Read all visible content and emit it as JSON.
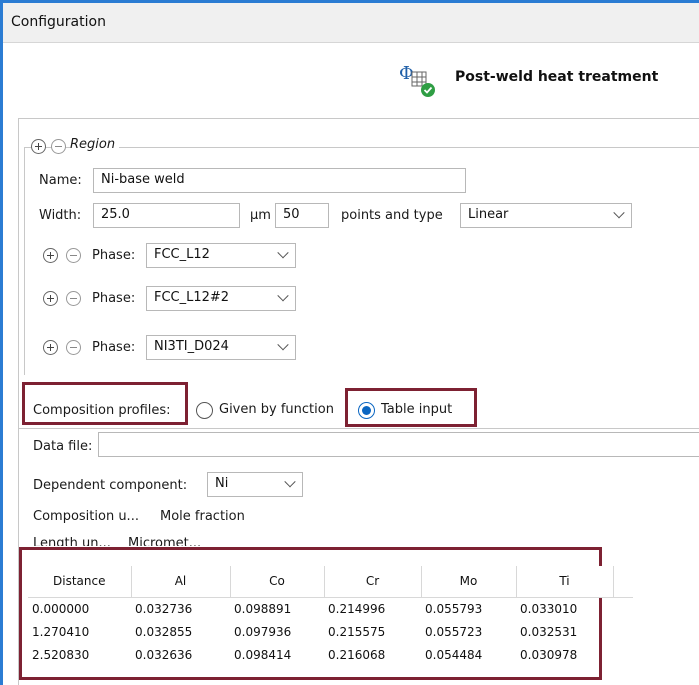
{
  "window": {
    "title": "Configuration"
  },
  "header": {
    "title": "Post-weld heat treatment",
    "icon": "phase-diagram-check-icon"
  },
  "region": {
    "legend": "Region",
    "name_label": "Name:",
    "name_value": "Ni-base weld",
    "width_label": "Width:",
    "width_value": "25.0",
    "width_unit": "µm",
    "points_value": "50",
    "points_label": "points and type",
    "type_value": "Linear",
    "phases": [
      {
        "label": "Phase:",
        "value": "FCC_L12"
      },
      {
        "label": "Phase:",
        "value": "FCC_L12#2"
      },
      {
        "label": "Phase:",
        "value": "NI3TI_D024"
      }
    ]
  },
  "composition": {
    "profiles_label": "Composition profiles:",
    "option_function": "Given by function",
    "option_table": "Table input",
    "selected": "Table input",
    "data_file_label": "Data file:",
    "data_file_value": "",
    "dependent_label": "Dependent component:",
    "dependent_value": "Ni",
    "comp_unit_label": "Composition u...",
    "comp_unit_value": "Mole fraction",
    "length_unit_label": "Length un...",
    "length_unit_value": "Micromet..."
  },
  "table": {
    "columns": [
      "Distance",
      "Al",
      "Co",
      "Cr",
      "Mo",
      "Ti"
    ],
    "rows": [
      [
        "0.000000",
        "0.032736",
        "0.098891",
        "0.214996",
        "0.055793",
        "0.033010"
      ],
      [
        "1.270410",
        "0.032855",
        "0.097936",
        "0.215575",
        "0.055723",
        "0.032531"
      ],
      [
        "2.520830",
        "0.032636",
        "0.098414",
        "0.216068",
        "0.054484",
        "0.030978"
      ]
    ]
  },
  "colors": {
    "highlight": "#7d2132",
    "accent": "#0a66c2",
    "window_border": "#2b7cd3"
  }
}
